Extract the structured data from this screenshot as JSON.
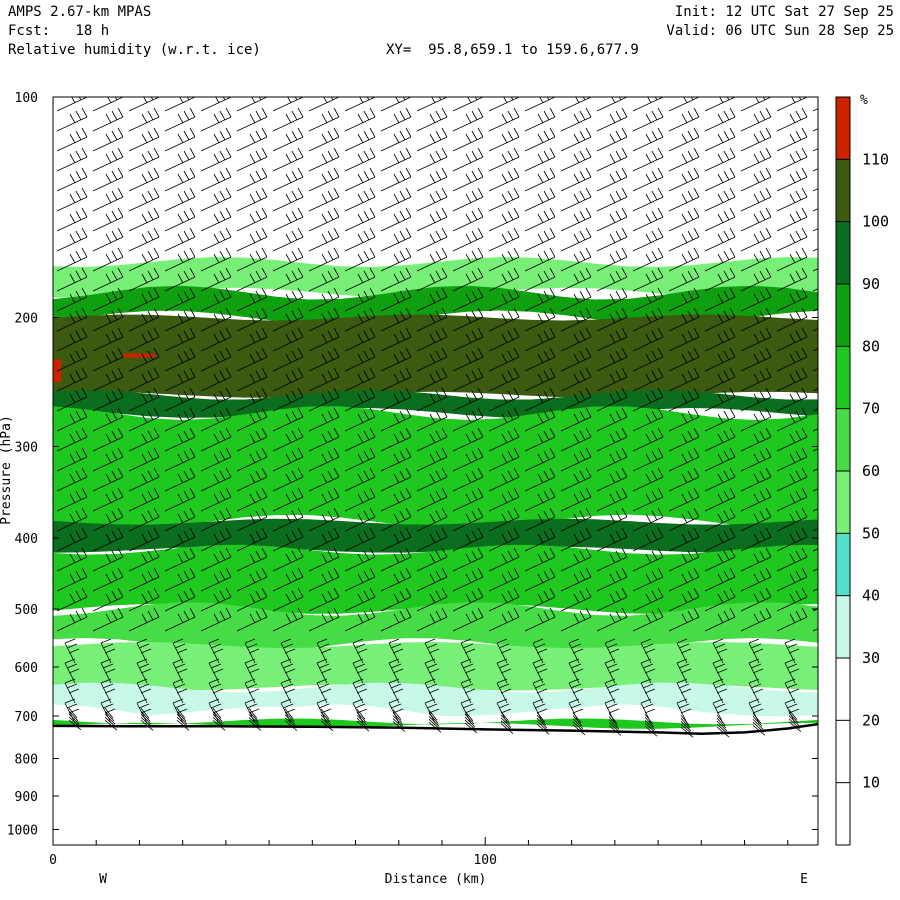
{
  "header": {
    "model": "AMPS 2.67-km MPAS",
    "fcst": "Fcst:   18 h",
    "field": "Relative humidity (w.r.t. ice)",
    "xy": "XY=  95.8,659.1 to 159.6,677.9",
    "init": "Init: 12 UTC Sat 27 Sep 25",
    "valid": "Valid: 06 UTC Sun 28 Sep 25"
  },
  "axes": {
    "ylabel": "Pressure (hPa)",
    "xlabel": "Distance (km)",
    "west": "W",
    "east": "E"
  },
  "colorbar": {
    "unit": "%",
    "levels": [
      10,
      20,
      30,
      40,
      50,
      60,
      70,
      80,
      90,
      100,
      110
    ],
    "colors": [
      "#ffffff",
      "#ffffff",
      "#ffffff",
      "#c8f8e8",
      "#50e0c8",
      "#78f078",
      "#46dc46",
      "#1ec81e",
      "#0ea00e",
      "#0a6e1e",
      "#3c5a10",
      "#cc2200"
    ]
  },
  "chart_data": {
    "type": "heatmap",
    "title": "Relative humidity (w.r.t. ice)",
    "xlabel": "Distance (km)",
    "ylabel": "Pressure (hPa)",
    "xlim": [
      0,
      177
    ],
    "ylim": [
      1050,
      100
    ],
    "y_scale": "log",
    "x_ticks": [
      0,
      100
    ],
    "y_ticks": [
      100,
      200,
      300,
      400,
      500,
      600,
      700,
      800,
      900,
      1000
    ],
    "colorbar_levels": [
      10,
      20,
      30,
      40,
      50,
      60,
      70,
      80,
      90,
      100,
      110
    ],
    "surface_pressure_hpa": {
      "x": [
        0,
        20,
        40,
        60,
        80,
        100,
        120,
        140,
        150,
        160,
        170,
        177
      ],
      "p": [
        722,
        723,
        723,
        724,
        726,
        730,
        733,
        737,
        740,
        737,
        728,
        718
      ]
    },
    "rh_bands": [
      {
        "p_top": 100,
        "p_bottom": 168,
        "rh_percent": 10
      },
      {
        "p_top": 168,
        "p_bottom": 185,
        "rh_percent": 55
      },
      {
        "p_top": 185,
        "p_bottom": 200,
        "rh_percent": 85
      },
      {
        "p_top": 200,
        "p_bottom": 255,
        "rh_percent": 105
      },
      {
        "p_top": 255,
        "p_bottom": 270,
        "rh_percent": 90
      },
      {
        "p_top": 270,
        "p_bottom": 380,
        "rh_percent": 72
      },
      {
        "p_top": 380,
        "p_bottom": 415,
        "rh_percent": 95
      },
      {
        "p_top": 415,
        "p_bottom": 500,
        "rh_percent": 70
      },
      {
        "p_top": 500,
        "p_bottom": 560,
        "rh_percent": 62
      },
      {
        "p_top": 560,
        "p_bottom": 640,
        "rh_percent": 52
      },
      {
        "p_top": 640,
        "p_bottom": 690,
        "rh_percent": 38
      },
      {
        "p_top": 690,
        "p_bottom": 712,
        "rh_percent": 25
      },
      {
        "p_top": 712,
        "p_bottom": 722,
        "rh_percent": 75
      }
    ]
  }
}
